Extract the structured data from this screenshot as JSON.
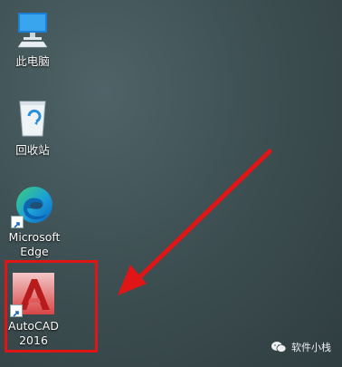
{
  "desktop": {
    "icons": [
      {
        "label": "此电脑"
      },
      {
        "label": "回收站"
      },
      {
        "label": "Microsoft\nEdge"
      },
      {
        "label": "AutoCAD\n2016"
      }
    ]
  },
  "watermark": {
    "text": "软件小栈"
  },
  "colors": {
    "highlight": "#e01515",
    "arrow": "#e01515"
  }
}
